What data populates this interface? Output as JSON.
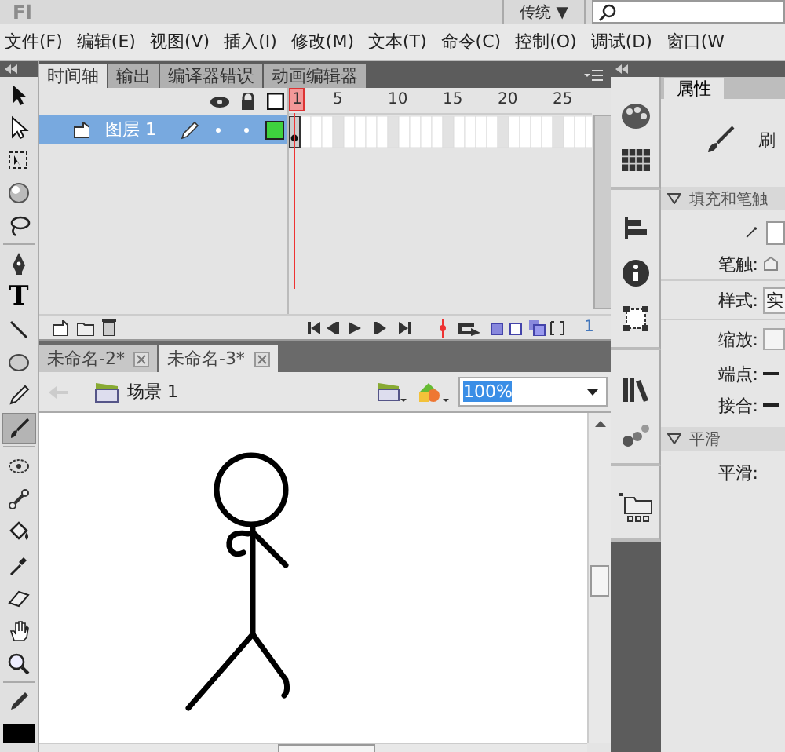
{
  "app": {
    "logo": "Fl"
  },
  "workspace": {
    "label": "传统",
    "caret": "▼"
  },
  "menu": [
    "文件(F)",
    "编辑(E)",
    "视图(V)",
    "插入(I)",
    "修改(M)",
    "文本(T)",
    "命令(C)",
    "控制(O)",
    "调试(D)",
    "窗口(W"
  ],
  "timeline": {
    "tabs": [
      {
        "label": "时间轴",
        "selected": true
      },
      {
        "label": "输出",
        "selected": false
      },
      {
        "label": "编译器错误",
        "selected": false
      },
      {
        "label": "动画编辑器",
        "selected": false
      }
    ],
    "layers": [
      {
        "name": "图层 1",
        "selected": true
      }
    ],
    "ruler": [
      "1",
      "5",
      "10",
      "15",
      "20",
      "25"
    ],
    "current_frame": "1"
  },
  "documents": [
    {
      "label": "未命名-2*",
      "selected": false
    },
    {
      "label": "未命名-3*",
      "selected": true
    }
  ],
  "scene": {
    "label": "场景 1"
  },
  "zoom": {
    "value": "100%"
  },
  "tools": [
    {
      "selected": false
    },
    {
      "selected": false
    },
    {
      "selected": false
    },
    {
      "selected": false
    },
    {
      "selected": false
    },
    {
      "selected": false
    },
    {
      "selected": false,
      "glyph": "T"
    },
    {
      "selected": false
    },
    {
      "selected": false
    },
    {
      "selected": false
    },
    {
      "selected": true
    },
    {
      "selected": false
    },
    {
      "selected": false
    },
    {
      "selected": false
    },
    {
      "selected": false
    },
    {
      "selected": false
    },
    {
      "selected": false
    },
    {
      "selected": false
    },
    {
      "selected": false
    }
  ],
  "properties": {
    "tab": "属性",
    "tool_name": "刷",
    "sections": [
      {
        "title": "填充和笔触",
        "expanded": true,
        "rows": [
          {
            "kind": "swatch"
          },
          {
            "kind": "slider",
            "label": "笔触:"
          },
          {
            "kind": "dropdown",
            "label": "样式:",
            "value": "实"
          },
          {
            "kind": "field",
            "label": "缩放:"
          },
          {
            "kind": "cap",
            "label": "端点:"
          },
          {
            "kind": "cap",
            "label": "接合:"
          }
        ]
      },
      {
        "title": "平滑",
        "expanded": true,
        "rows": [
          {
            "kind": "text",
            "label": "平滑:"
          }
        ]
      }
    ]
  }
}
